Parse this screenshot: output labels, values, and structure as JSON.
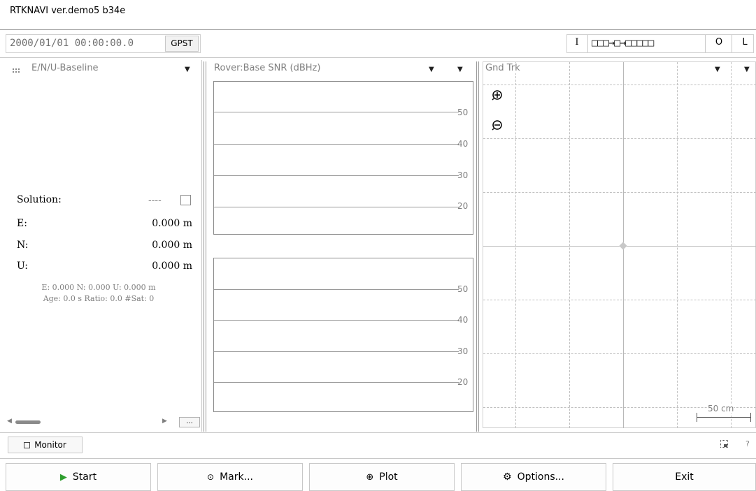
{
  "window": {
    "title": "RTKNAVI ver.demo5 b34e"
  },
  "toolbar": {
    "time": "2000/01/01 00:00:00.0",
    "time_system": "GPST",
    "stream_input": "I",
    "stream_indicators": "□□□→□→□□□□□",
    "stream_output": "O",
    "stream_log": "L"
  },
  "left_panel": {
    "title": "E/N/U-Baseline",
    "solution_label": "Solution:",
    "solution_value": "----",
    "e_label": "E:",
    "e_value": "0.000 m",
    "n_label": "N:",
    "n_value": "0.000 m",
    "u_label": "U:",
    "u_value": "0.000 m",
    "summary_line1": "E: 0.000 N: 0.000 U: 0.000 m",
    "summary_line2": "Age: 0.0 s Ratio: 0.0 #Sat: 0",
    "more_button": "..."
  },
  "snr_panel": {
    "title": "Rover:Base  SNR (dBHz)",
    "ticks": [
      "50",
      "40",
      "30",
      "20"
    ]
  },
  "map_panel": {
    "title": "Gnd Trk",
    "scale_label": "50 cm"
  },
  "bottom": {
    "monitor_label": "Monitor",
    "help_label": "?",
    "start_label": "Start",
    "mark_label": "Mark...",
    "plot_label": "Plot",
    "options_label": "Options...",
    "exit_label": "Exit"
  },
  "colors": {
    "start_icon": "#2e9e2e",
    "grid": "#c0c0c0",
    "label_grey": "#808080"
  }
}
